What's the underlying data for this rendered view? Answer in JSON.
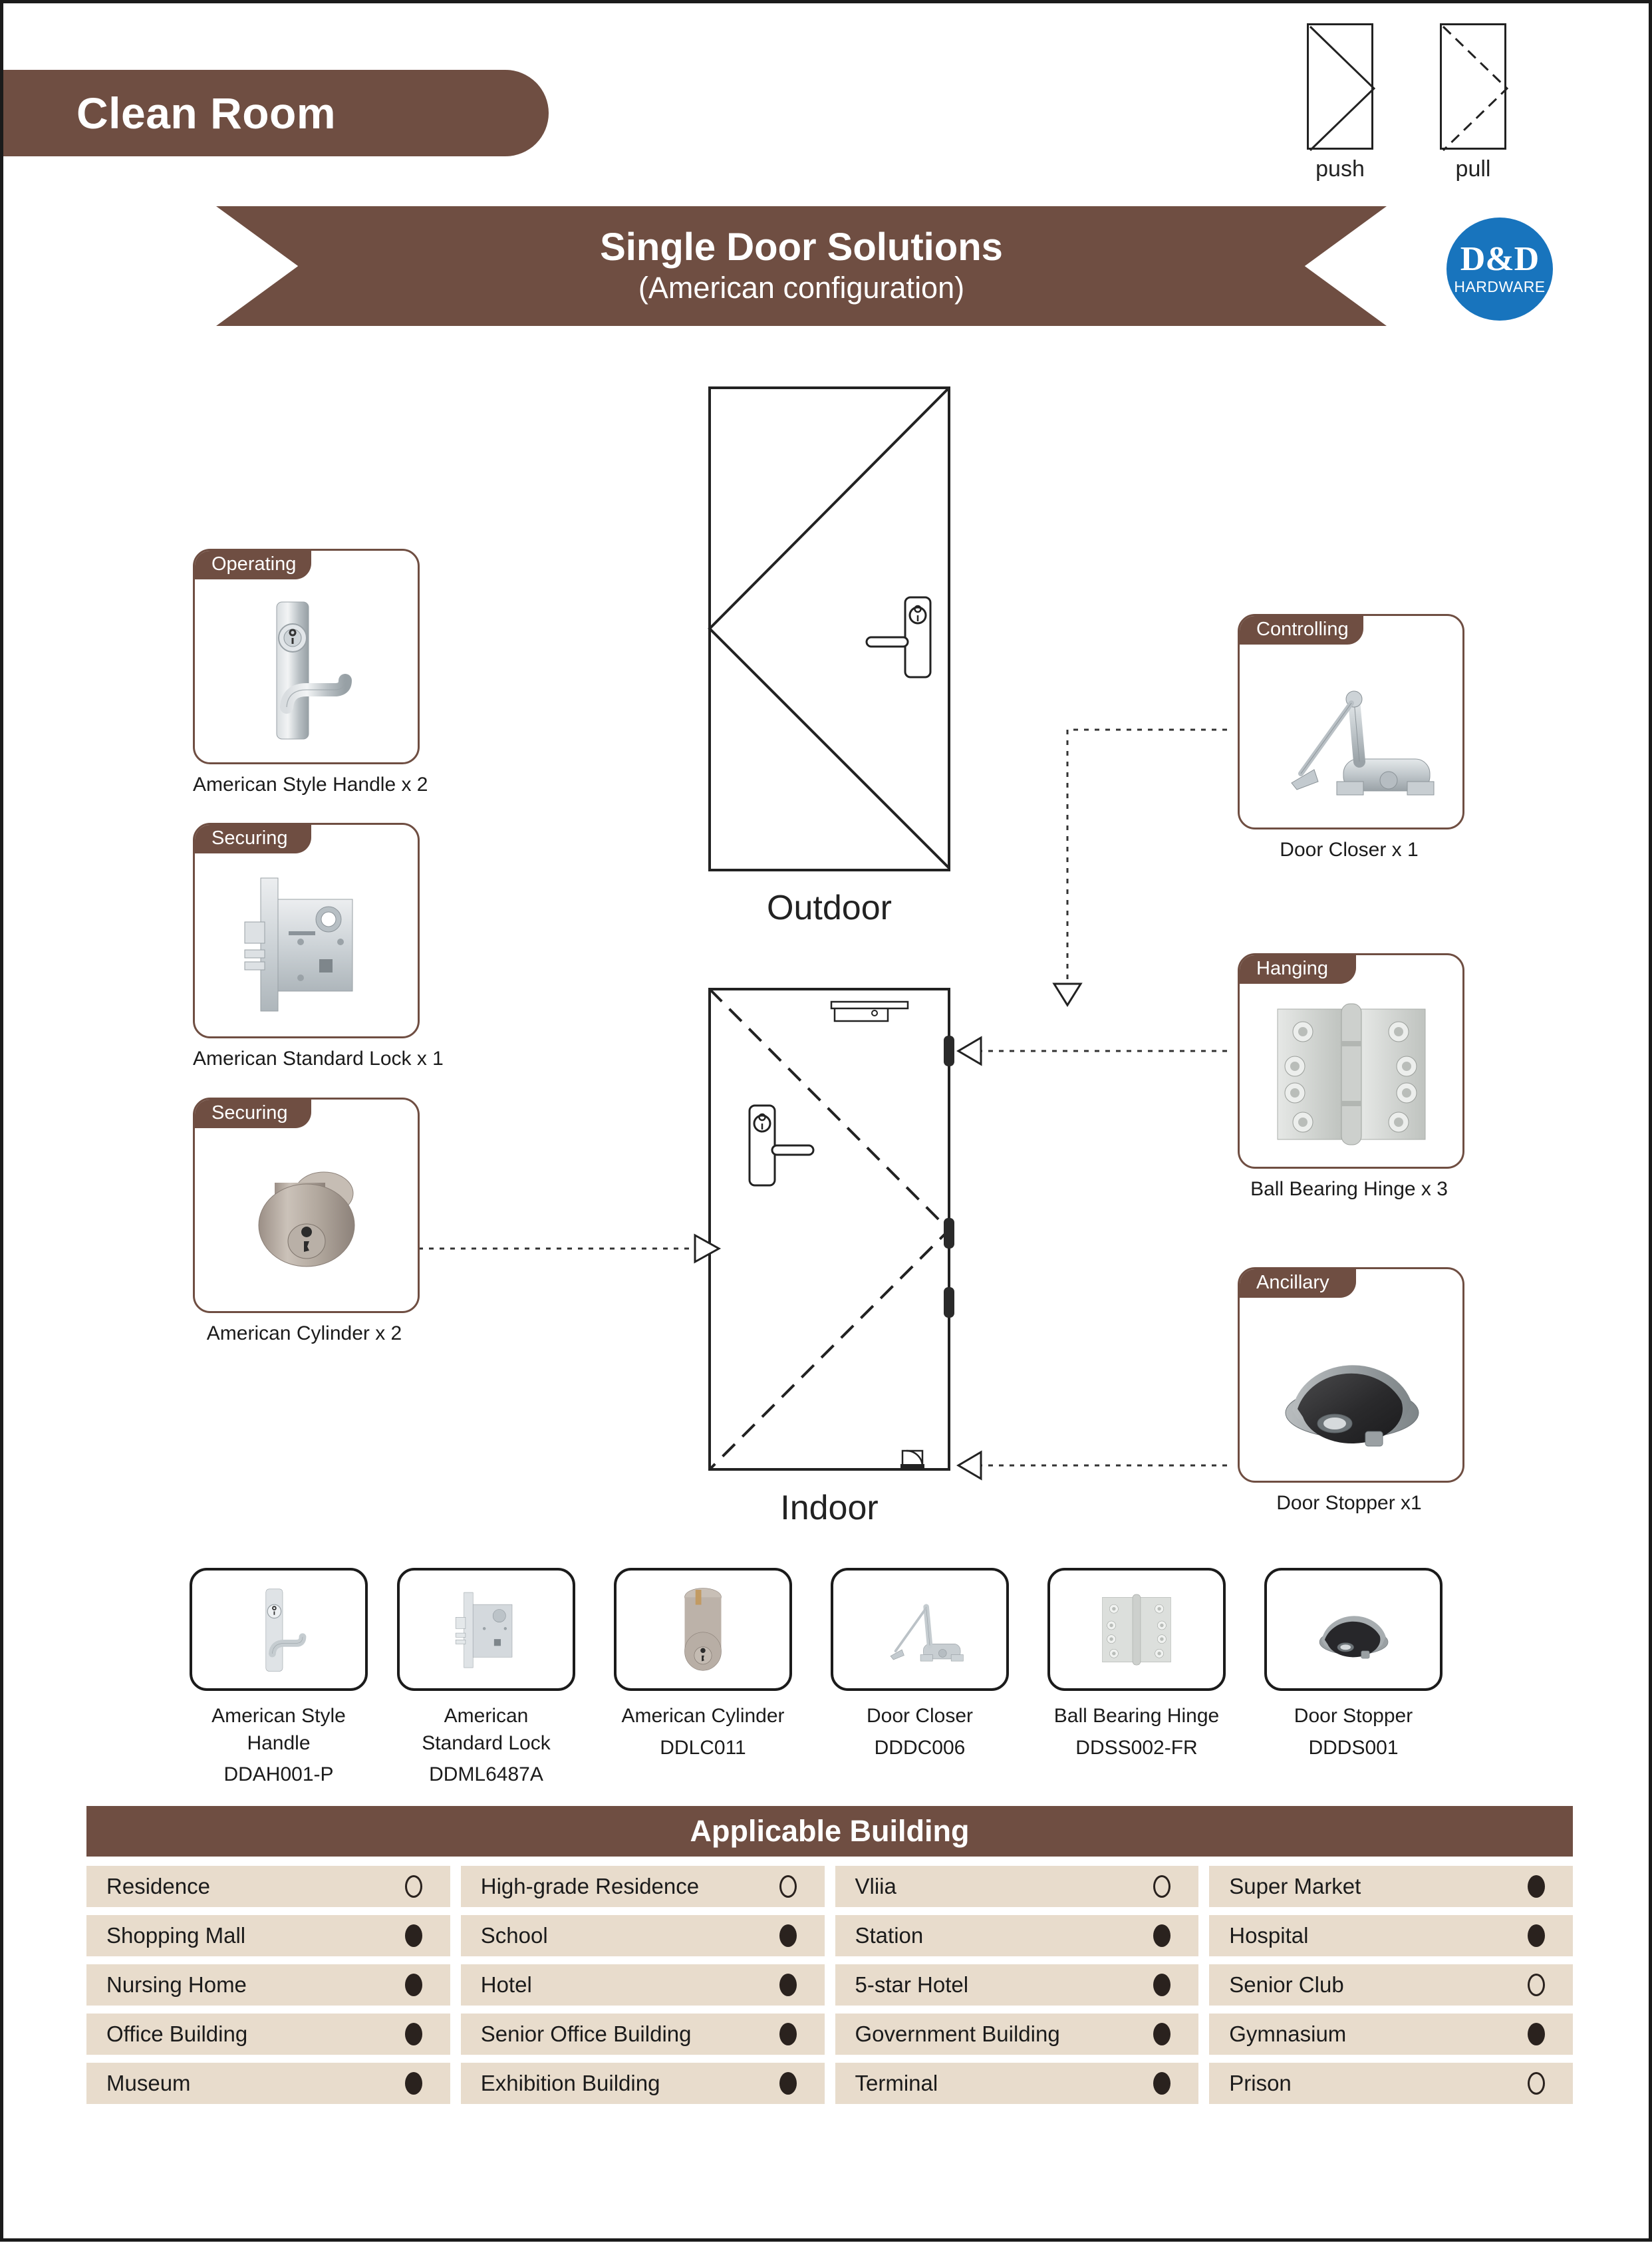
{
  "header": {
    "room_tab_label": "Clean Room",
    "banner_title": "Single Door Solutions",
    "banner_subtitle": "(American configuration)",
    "logo_main": "D&D",
    "logo_sub": "HARDWARE",
    "swing_symbols": [
      {
        "name": "push-symbol",
        "caption": "push",
        "line_style": "solid"
      },
      {
        "name": "pull-symbol",
        "caption": "pull",
        "line_style": "dashed"
      }
    ]
  },
  "colors": {
    "brand_brown": "#6F4E42",
    "table_cell_beige": "#E8DCCC",
    "logo_blue": "#1874BD",
    "outline_black": "#1b1b1b"
  },
  "left_cards": [
    {
      "tab": "Operating",
      "caption": "American Style Handle x 2",
      "icon": "lever-handle-on-plate"
    },
    {
      "tab": "Securing",
      "caption": "American Standard Lock x 1",
      "icon": "mortise-lock-body"
    },
    {
      "tab": "Securing",
      "caption": "American Cylinder x 2",
      "icon": "rim-cylinder"
    }
  ],
  "right_cards": [
    {
      "tab": "Controlling",
      "caption": "Door Closer x 1",
      "icon": "door-closer"
    },
    {
      "tab": "Hanging",
      "caption": "Ball Bearing Hinge x 3",
      "icon": "ball-bearing-hinge"
    },
    {
      "tab": "Ancillary",
      "caption": "Door Stopper x1",
      "icon": "floor-door-stopper"
    }
  ],
  "diagrams": {
    "outdoor_label": "Outdoor",
    "indoor_label": "Indoor"
  },
  "product_strip": [
    {
      "name": "American Style Handle",
      "model": "DDAH001-P",
      "icon": "lever-handle-on-plate"
    },
    {
      "name": "American\nStandard Lock",
      "model": "DDML6487A",
      "icon": "mortise-lock-body"
    },
    {
      "name": "American Cylinder",
      "model": "DDLC011",
      "icon": "rim-cylinder"
    },
    {
      "name": "Door Closer",
      "model": "DDDC006",
      "icon": "door-closer"
    },
    {
      "name": "Ball Bearing Hinge",
      "model": "DDSS002-FR",
      "icon": "ball-bearing-hinge"
    },
    {
      "name": "Door Stopper",
      "model": "DDDS001",
      "icon": "floor-door-stopper"
    }
  ],
  "applicable_building": {
    "title": "Applicable Building",
    "rows": [
      [
        {
          "label": "Residence",
          "mark": "open"
        },
        {
          "label": "High-grade Residence",
          "mark": "open"
        },
        {
          "label": "Vliia",
          "mark": "open"
        },
        {
          "label": "Super Market",
          "mark": "filled"
        }
      ],
      [
        {
          "label": "Shopping Mall",
          "mark": "filled"
        },
        {
          "label": "School",
          "mark": "filled"
        },
        {
          "label": "Station",
          "mark": "filled"
        },
        {
          "label": "Hospital",
          "mark": "filled"
        }
      ],
      [
        {
          "label": "Nursing Home",
          "mark": "filled"
        },
        {
          "label": "Hotel",
          "mark": "filled"
        },
        {
          "label": "5-star Hotel",
          "mark": "filled"
        },
        {
          "label": "Senior Club",
          "mark": "open"
        }
      ],
      [
        {
          "label": "Office Building",
          "mark": "filled"
        },
        {
          "label": "Senior Office Building",
          "mark": "filled"
        },
        {
          "label": "Government Building",
          "mark": "filled"
        },
        {
          "label": "Gymnasium",
          "mark": "filled"
        }
      ],
      [
        {
          "label": "Museum",
          "mark": "filled"
        },
        {
          "label": "Exhibition Building",
          "mark": "filled"
        },
        {
          "label": "Terminal",
          "mark": "filled"
        },
        {
          "label": "Prison",
          "mark": "open"
        }
      ]
    ]
  }
}
